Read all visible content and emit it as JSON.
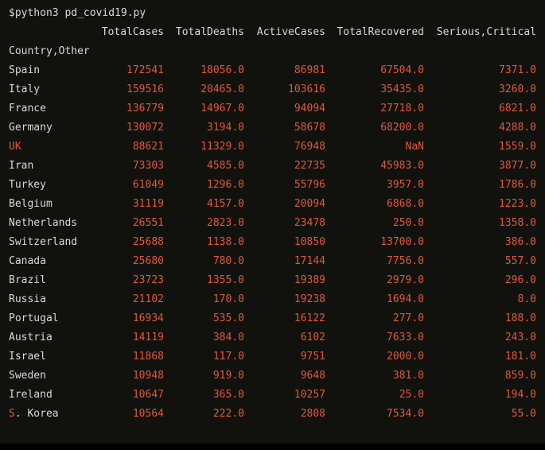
{
  "terminal": {
    "command": "$python3 pd_covid19.py",
    "columns": [
      "TotalCases",
      "TotalDeaths",
      "ActiveCases",
      "TotalRecovered",
      "Serious,Critical"
    ],
    "index_name": "Country,Other",
    "rows": [
      {
        "country": "Spain",
        "total_cases": "172541",
        "total_deaths": "18056.0",
        "active_cases": "86981",
        "total_recovered": "67504.0",
        "serious_critical": "7371.0"
      },
      {
        "country": "Italy",
        "total_cases": "159516",
        "total_deaths": "20465.0",
        "active_cases": "103616",
        "total_recovered": "35435.0",
        "serious_critical": "3260.0"
      },
      {
        "country": "France",
        "total_cases": "136779",
        "total_deaths": "14967.0",
        "active_cases": "94094",
        "total_recovered": "27718.0",
        "serious_critical": "6821.0"
      },
      {
        "country": "Germany",
        "total_cases": "130072",
        "total_deaths": "3194.0",
        "active_cases": "58678",
        "total_recovered": "68200.0",
        "serious_critical": "4288.0"
      },
      {
        "country": "UK",
        "total_cases": "88621",
        "total_deaths": "11329.0",
        "active_cases": "76948",
        "total_recovered": "NaN",
        "serious_critical": "1559.0"
      },
      {
        "country": "Iran",
        "total_cases": "73303",
        "total_deaths": "4585.0",
        "active_cases": "22735",
        "total_recovered": "45983.0",
        "serious_critical": "3877.0"
      },
      {
        "country": "Turkey",
        "total_cases": "61049",
        "total_deaths": "1296.0",
        "active_cases": "55796",
        "total_recovered": "3957.0",
        "serious_critical": "1786.0"
      },
      {
        "country": "Belgium",
        "total_cases": "31119",
        "total_deaths": "4157.0",
        "active_cases": "20094",
        "total_recovered": "6868.0",
        "serious_critical": "1223.0"
      },
      {
        "country": "Netherlands",
        "total_cases": "26551",
        "total_deaths": "2823.0",
        "active_cases": "23478",
        "total_recovered": "250.0",
        "serious_critical": "1358.0"
      },
      {
        "country": "Switzerland",
        "total_cases": "25688",
        "total_deaths": "1138.0",
        "active_cases": "10850",
        "total_recovered": "13700.0",
        "serious_critical": "386.0"
      },
      {
        "country": "Canada",
        "total_cases": "25680",
        "total_deaths": "780.0",
        "active_cases": "17144",
        "total_recovered": "7756.0",
        "serious_critical": "557.0"
      },
      {
        "country": "Brazil",
        "total_cases": "23723",
        "total_deaths": "1355.0",
        "active_cases": "19389",
        "total_recovered": "2979.0",
        "serious_critical": "296.0"
      },
      {
        "country": "Russia",
        "total_cases": "21102",
        "total_deaths": "170.0",
        "active_cases": "19238",
        "total_recovered": "1694.0",
        "serious_critical": "8.0"
      },
      {
        "country": "Portugal",
        "total_cases": "16934",
        "total_deaths": "535.0",
        "active_cases": "16122",
        "total_recovered": "277.0",
        "serious_critical": "188.0"
      },
      {
        "country": "Austria",
        "total_cases": "14119",
        "total_deaths": "384.0",
        "active_cases": "6102",
        "total_recovered": "7633.0",
        "serious_critical": "243.0"
      },
      {
        "country": "Israel",
        "total_cases": "11868",
        "total_deaths": "117.0",
        "active_cases": "9751",
        "total_recovered": "2000.0",
        "serious_critical": "181.0"
      },
      {
        "country": "Sweden",
        "total_cases": "10948",
        "total_deaths": "919.0",
        "active_cases": "9648",
        "total_recovered": "381.0",
        "serious_critical": "859.0"
      },
      {
        "country": "Ireland",
        "total_cases": "10647",
        "total_deaths": "365.0",
        "active_cases": "10257",
        "total_recovered": "25.0",
        "serious_critical": "194.0"
      },
      {
        "country": "S. Korea",
        "total_cases": "10564",
        "total_deaths": "222.0",
        "active_cases": "2808",
        "total_recovered": "7534.0",
        "serious_critical": "55.0"
      }
    ]
  },
  "colors": {
    "background": "#11120e",
    "text": "#d8d8d8",
    "number": "#e0573a"
  }
}
